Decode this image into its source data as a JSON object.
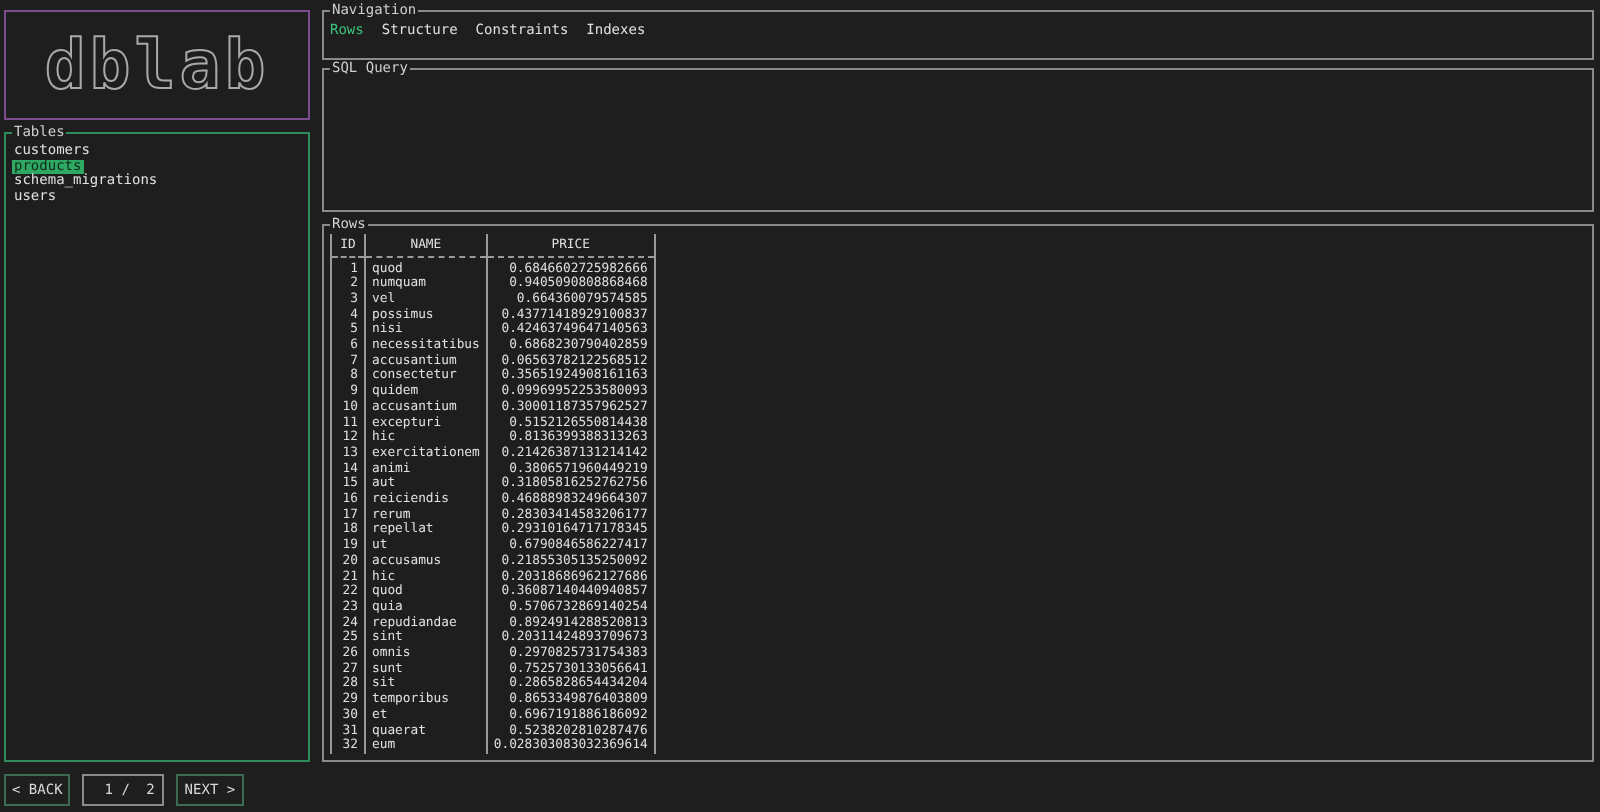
{
  "logo": {
    "text": "dblab"
  },
  "tables": {
    "title": "Tables",
    "items": [
      {
        "name": "customers",
        "selected": false
      },
      {
        "name": "products",
        "selected": true
      },
      {
        "name": "schema_migrations",
        "selected": false
      },
      {
        "name": "users",
        "selected": false
      }
    ]
  },
  "navigation": {
    "title": "Navigation",
    "tabs": [
      {
        "label": "Rows",
        "selected": true
      },
      {
        "label": "Structure",
        "selected": false
      },
      {
        "label": "Constraints",
        "selected": false
      },
      {
        "label": "Indexes",
        "selected": false
      }
    ]
  },
  "sql_query": {
    "title": "SQL Query"
  },
  "rows": {
    "title": "Rows",
    "columns": [
      "ID",
      "NAME",
      "PRICE"
    ],
    "rows": [
      [
        "1",
        "quod",
        "0.6846602725982666"
      ],
      [
        "2",
        "numquam",
        "0.9405090808868468"
      ],
      [
        "3",
        "vel",
        "0.664360079574585"
      ],
      [
        "4",
        "possimus",
        "0.43771418929100837"
      ],
      [
        "5",
        "nisi",
        "0.42463749647140563"
      ],
      [
        "6",
        "necessitatibus",
        "0.6868230790402859"
      ],
      [
        "7",
        "accusantium",
        "0.06563782122568512"
      ],
      [
        "8",
        "consectetur",
        "0.35651924908161163"
      ],
      [
        "9",
        "quidem",
        "0.09969952253580093"
      ],
      [
        "10",
        "accusantium",
        "0.30001187357962527"
      ],
      [
        "11",
        "excepturi",
        "0.5152126550814438"
      ],
      [
        "12",
        "hic",
        "0.8136399388313263"
      ],
      [
        "13",
        "exercitationem",
        "0.21426387131214142"
      ],
      [
        "14",
        "animi",
        "0.3806571960449219"
      ],
      [
        "15",
        "aut",
        "0.31805816252762756"
      ],
      [
        "16",
        "reiciendis",
        "0.46888983249664307"
      ],
      [
        "17",
        "rerum",
        "0.28303414583206177"
      ],
      [
        "18",
        "repellat",
        "0.29310164717178345"
      ],
      [
        "19",
        "ut",
        "0.6790846586227417"
      ],
      [
        "20",
        "accusamus",
        "0.21855305135250092"
      ],
      [
        "21",
        "hic",
        "0.20318686962127686"
      ],
      [
        "22",
        "quod",
        "0.36087140440940857"
      ],
      [
        "23",
        "quia",
        "0.5706732869140254"
      ],
      [
        "24",
        "repudiandae",
        "0.8924914288520813"
      ],
      [
        "25",
        "sint",
        "0.20311424893709673"
      ],
      [
        "26",
        "omnis",
        "0.2970825731754383"
      ],
      [
        "27",
        "sunt",
        "0.7525730133056641"
      ],
      [
        "28",
        "sit",
        "0.2865828654434204"
      ],
      [
        "29",
        "temporibus",
        "0.8653349876403809"
      ],
      [
        "30",
        "et",
        "0.6967191886186092"
      ],
      [
        "31",
        "quaerat",
        "0.5238202810287476"
      ],
      [
        "32",
        "eum",
        "0.028303083032369614"
      ]
    ]
  },
  "pagination": {
    "back": "< BACK",
    "current": "1 /",
    "total": "2",
    "next": "NEXT >"
  }
}
